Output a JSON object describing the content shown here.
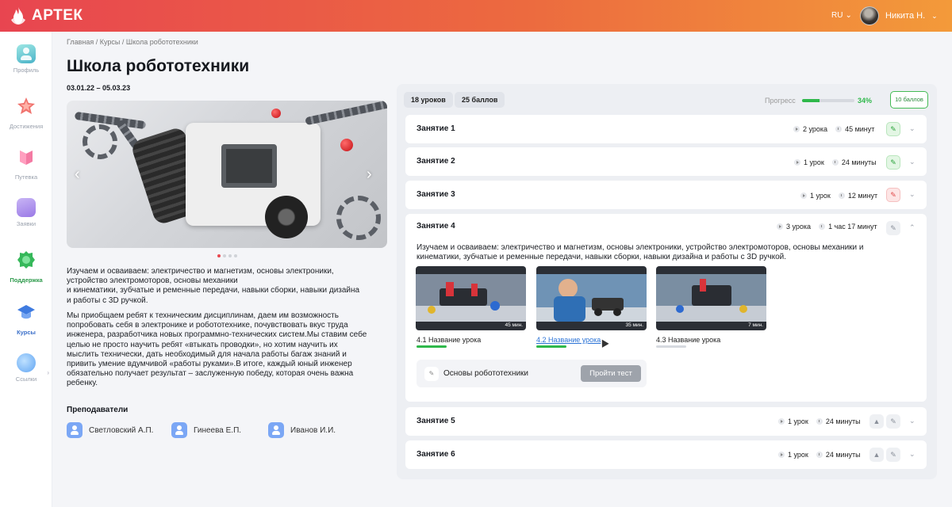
{
  "brand": {
    "name": "АРТЕК"
  },
  "header": {
    "lang": "RU",
    "user_name": "Никита Н."
  },
  "sidebar": {
    "items": [
      {
        "label": "Профиль"
      },
      {
        "label": "Достижения"
      },
      {
        "label": "Путевка"
      },
      {
        "label": "Заявки"
      },
      {
        "label": "Поддержка"
      },
      {
        "label": "Курсы"
      },
      {
        "label": "Ссылки"
      }
    ]
  },
  "breadcrumbs": "Главная / Курсы / Школа робототехники",
  "course": {
    "title": "Школа робототехники",
    "dates": "03.01.22 – 05.03.23",
    "description_1": "Изучаем и осваиваем: электричество и магнетизм, основы электроники, устройство электромоторов, основы механики\nи кинематики, зубчатые и ременные передачи, навыки сборки, навыки дизайна\nи работы с 3D ручкой.",
    "description_2": "Мы приобщаем ребят к техническим дисциплинам, даем им возможность попробовать себя в электронике и робототехнике, почувствовать вкус труда инженера, разработчика новых программно-технических систем.Мы ставим себе целью не просто научить ребят «втыкать проводки», но хотим научить их мыслить технически, дать необходимый для начала работы багаж знаний и привить умение вдумчивой «работы руками».В итоге, каждый юный инженер обязательно получает результат – заслуженную победу, которая очень важна ребенку."
  },
  "teachers": {
    "title": "Преподаватели",
    "list": [
      {
        "name": "Светловский А.П."
      },
      {
        "name": "Гинеева Е.П."
      },
      {
        "name": "Иванов И.И."
      }
    ]
  },
  "summary": {
    "lessons_chip": "18 уроков",
    "points_chip": "25 баллов",
    "progress_label": "Прогресс",
    "progress_value": "34%",
    "progress_fraction": 0.34,
    "score_button": "10 баллов"
  },
  "lessons": [
    {
      "title": "Занятие 1",
      "count": "2 урока",
      "time": "45 минут",
      "state": "green"
    },
    {
      "title": "Занятие 2",
      "count": "1 урок",
      "time": "24 минуты",
      "state": "green"
    },
    {
      "title": "Занятие 3",
      "count": "1 урок",
      "time": "12 минут",
      "state": "red"
    },
    {
      "title": "Занятие 4",
      "count": "3 урока",
      "time": "1 час 17 минут",
      "state": "grey",
      "description": "Изучаем и осваиваем: электричество и магнетизм, основы электроники, устройство электромоторов, основы механики и кинематики, зубчатые и ременные передачи, навыки сборки, навыки дизайна и работы с 3D ручкой.",
      "videos": [
        {
          "title": "4.1 Название урока",
          "duration": "45 мин."
        },
        {
          "title": "4.2 Название урока",
          "duration": "35 мин."
        },
        {
          "title": "4.3 Название урока",
          "duration": "7 мин."
        }
      ],
      "test": {
        "title": "Основы робототехники",
        "button": "Пройти тест"
      }
    },
    {
      "title": "Занятие 5",
      "count": "1 урок",
      "time": "24 минуты",
      "state": "grey"
    },
    {
      "title": "Занятие 6",
      "count": "1 урок",
      "time": "24 минуты",
      "state": "grey"
    }
  ],
  "colors": {
    "header_start": "#e84550",
    "header_end": "#f39a3a",
    "success": "#2fb84b",
    "danger": "#e14b4b",
    "link": "#2b73d6"
  }
}
